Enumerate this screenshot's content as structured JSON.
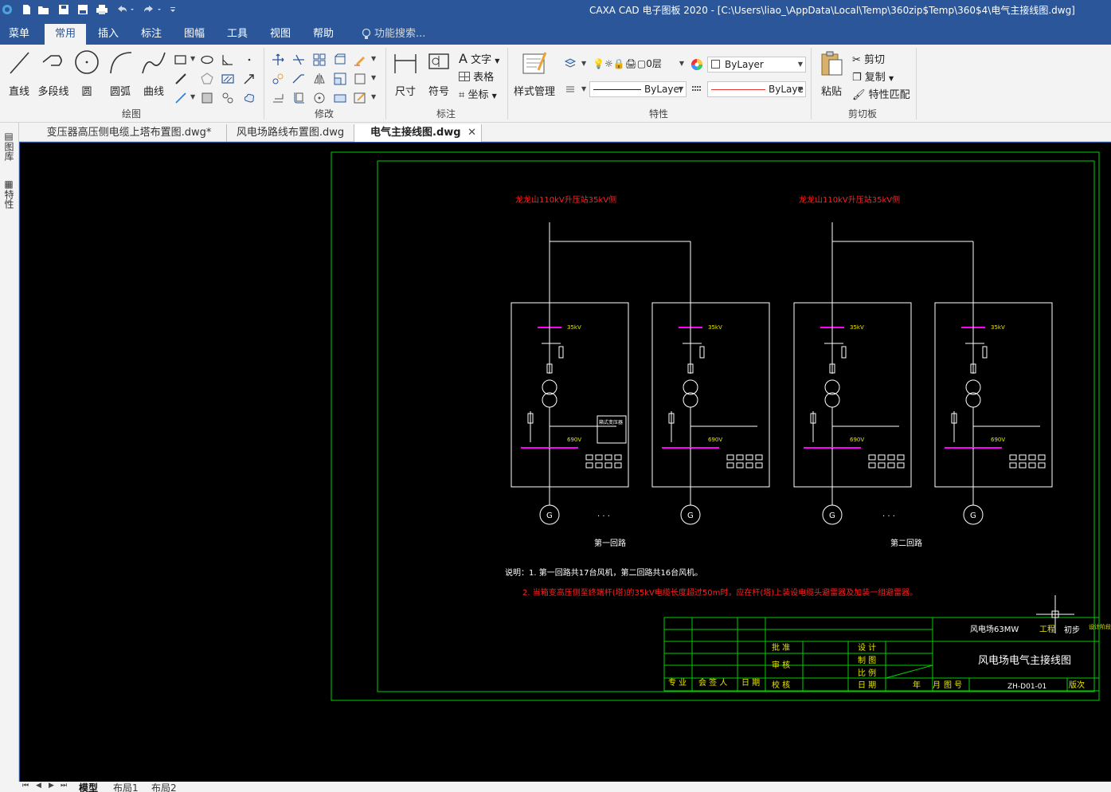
{
  "titlebar": {
    "title": "CAXA CAD 电子图板 2020 - [C:\\Users\\liao_\\AppData\\Local\\Temp\\360zip$Temp\\360$4\\电气主接线图.dwg]"
  },
  "menu": {
    "tabs": [
      "菜单",
      "常用",
      "插入",
      "标注",
      "图幅",
      "工具",
      "视图",
      "帮助"
    ],
    "search_placeholder": "功能搜索..."
  },
  "ribbon": {
    "draw": {
      "group_title": "绘图",
      "line": "直线",
      "polyline": "多段线",
      "circle": "圆",
      "arc": "圆弧",
      "curve": "曲线"
    },
    "modify": {
      "group_title": "修改"
    },
    "annotate": {
      "group_title": "标注",
      "dimension": "尺寸",
      "symbol": "符号",
      "text": "文字",
      "table": "表格",
      "coordinate": "坐标"
    },
    "properties": {
      "group_title": "特性",
      "style_manager": "样式管理",
      "layer": "0层",
      "color": "ByLayer",
      "linetype": "ByLayer",
      "lineweight": "ByLaye"
    },
    "clipboard": {
      "group_title": "剪切板",
      "paste": "粘贴",
      "cut": "剪切",
      "copy": "复制",
      "match": "特性匹配"
    }
  },
  "doc_tabs": [
    {
      "label": "变压器高压侧电缆上塔布置图.dwg*",
      "active": false
    },
    {
      "label": "风电场路线布置图.dwg",
      "active": false
    },
    {
      "label": "电气主接线图.dwg",
      "active": true
    }
  ],
  "side_tabs": [
    "图库",
    "特性"
  ],
  "layout_tabs": [
    "模型",
    "布局1",
    "布局2"
  ],
  "drawing": {
    "bus_label_1": "龙龙山110kV升压站35kV侧",
    "bus_label_2": "龙龙山110kV升压站35kV侧",
    "unit_voltage": "35kV",
    "gen_voltage": "690V",
    "gen_symbol": "G",
    "ellipsis": "· · ·",
    "loop_1": "第一回路",
    "loop_2": "第二回路",
    "note_1": "说明：1. 第一回路共17台风机，第二回路共16台风机。",
    "note_2": "2. 当箱变高压侧至终端杆(塔)的35kV电缆长度超过50m时，应在杆(塔)上装设电缆头避雷器及加装一组避雷器。",
    "box_text": "箱式变压器",
    "title_block": {
      "project": "风电场63MW",
      "stage_label": "工程",
      "stage_value": "初步",
      "design_stage": "设计阶段",
      "drawing_title": "风电场电气主接线图",
      "drawing_no": "ZH-D01-01",
      "version": "版次",
      "approve": "批 准",
      "review": "审 核",
      "check": "校 核",
      "design": "设 计",
      "draw": "制 图",
      "scale": "比 例",
      "date": "日 期",
      "year": "年",
      "month": "月",
      "drawing_no_label": "图 号",
      "specialty": "专 业",
      "signer": "会 签 人",
      "sign_date": "日 期"
    }
  }
}
